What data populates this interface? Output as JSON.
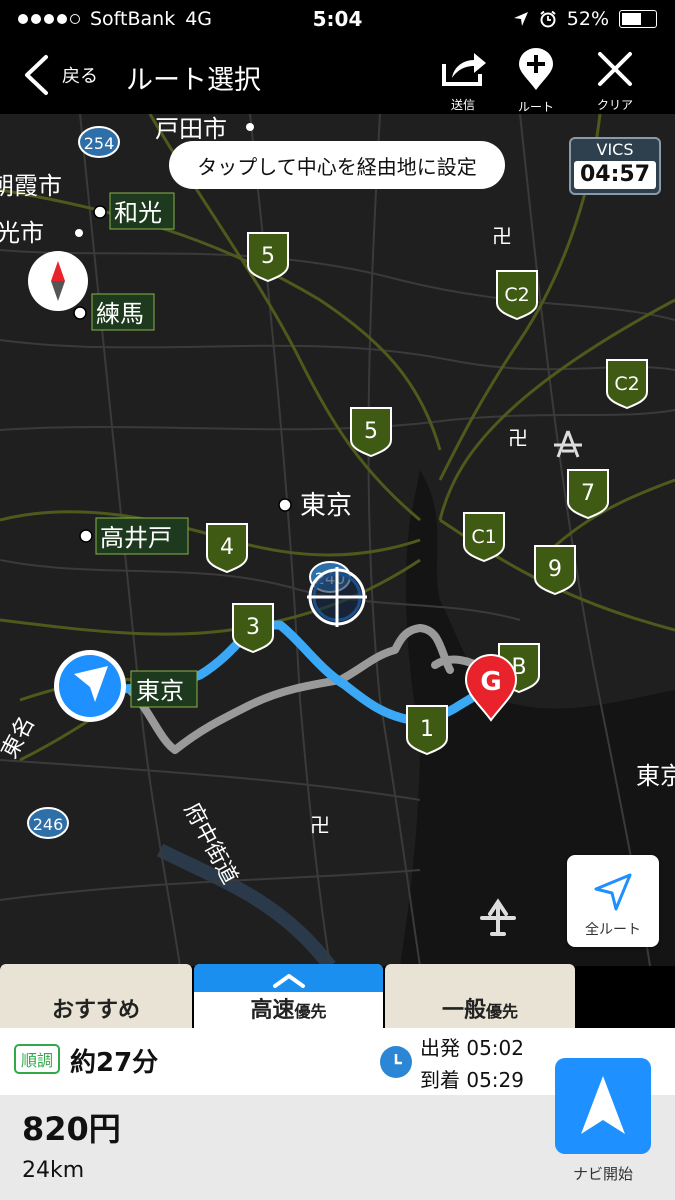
{
  "status_bar": {
    "carrier": "SoftBank",
    "network": "4G",
    "time": "5:04",
    "battery": "52%"
  },
  "nav_bar": {
    "back_label": "戻る",
    "title": "ルート選択",
    "send_label": "送信",
    "route_label": "ルート",
    "clear_label": "クリア"
  },
  "map": {
    "hint": "タップして中心を経由地に設定",
    "vics_label": "VICS",
    "vics_time": "04:57",
    "all_route_label": "全ルート",
    "places": [
      "戸田市",
      "和光",
      "光市",
      "朝霞市",
      "練馬",
      "東京",
      "高井戸",
      "東京",
      "東京",
      "府中街道",
      "東名"
    ],
    "shields": [
      "254",
      "246",
      "240",
      "5",
      "5",
      "C2",
      "C2",
      "7",
      "C1",
      "9",
      "4",
      "3",
      "1",
      "B"
    ],
    "goal_label": "G"
  },
  "tabs": {
    "recommended": "おすすめ",
    "highway_main": "高速",
    "highway_sub": "優先",
    "general_main": "一般",
    "general_sub": "優先",
    "active": "highway"
  },
  "route_info": {
    "status_badge": "順調",
    "duration": "約27分",
    "depart": "出発 05:02",
    "arrive": "到着 05:29",
    "toll": "820円",
    "distance": "24km",
    "nav_start_label": "ナビ開始"
  },
  "colors": {
    "route_active": "#3aa8f5",
    "tab_active": "#1a8ff0",
    "nav_start": "#1e90ff",
    "badge_green": "#31a84a",
    "goal_red": "#e8232b",
    "shield_green": "#3f5a12"
  }
}
